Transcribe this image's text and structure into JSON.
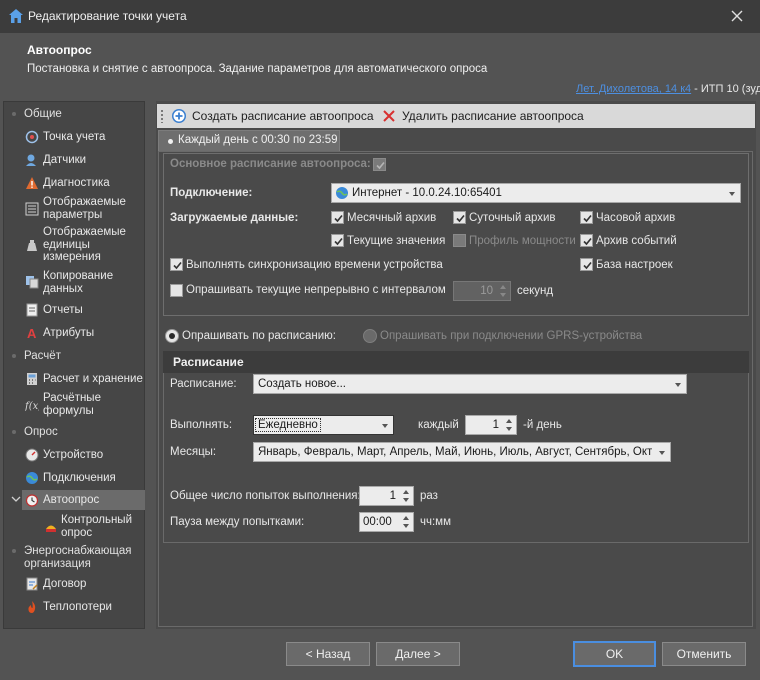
{
  "window": {
    "title": "Редактирование точки учета",
    "close_symbol": "✕"
  },
  "header": {
    "title": "Автоопрос",
    "description": "Постановка и снятие с автоопроса. Задание параметров для автоматического опроса",
    "link_text": "Лет. Дихолетова, 14 к4",
    "link_suffix": " - ИТП 10 (зуд"
  },
  "sidebar": {
    "sections": [
      {
        "label": "Общие"
      },
      {
        "label": "Расчёт"
      },
      {
        "label": "Опрос"
      },
      {
        "label": "Энергоснабжающая организация"
      }
    ],
    "items": [
      {
        "label": "Точка учета",
        "icon": "meter-point-icon"
      },
      {
        "label": "Датчики",
        "icon": "sensors-icon"
      },
      {
        "label": "Диагностика",
        "icon": "warning-icon"
      },
      {
        "label": "Отображаемые параметры",
        "icon": "params-list-icon"
      },
      {
        "label": "Отображаемые единицы измерения",
        "icon": "units-icon"
      },
      {
        "label": "Копирование данных",
        "icon": "copy-icon"
      },
      {
        "label": "Отчеты",
        "icon": "report-icon"
      },
      {
        "label": "Атрибуты",
        "icon": "attributes-icon"
      },
      {
        "label": "Расчет и хранение",
        "icon": "calculator-icon"
      },
      {
        "label": "Расчётные формулы",
        "icon": "formula-icon"
      },
      {
        "label": "Устройство",
        "icon": "device-icon"
      },
      {
        "label": "Подключения",
        "icon": "globe-icon"
      },
      {
        "label": "Автоопрос",
        "icon": "clock-icon"
      },
      {
        "label": "Контрольный опрос",
        "icon": "control-poll-icon"
      },
      {
        "label": "Договор",
        "icon": "contract-icon"
      },
      {
        "label": "Теплопотери",
        "icon": "flame-icon"
      }
    ]
  },
  "toolbar": {
    "create_label": "Создать расписание автоопроса",
    "delete_label": "Удалить расписание автоопроса"
  },
  "tab": {
    "label": "Каждый день с 00:30 по 23:59"
  },
  "form": {
    "main_schedule_label": "Основное расписание автоопроса:",
    "connection_label": "Подключение:",
    "connection_value": "Интернет - 10.0.24.10:65401",
    "loaded_data_label": "Загружаемые данные:",
    "checks": {
      "monthly": "Месячный архив",
      "daily": "Суточный архив",
      "hourly": "Часовой архив",
      "current": "Текущие значения",
      "power_profile": "Профиль мощности",
      "events": "Архив событий",
      "settings_db": "База настроек",
      "time_sync": "Выполнять синхронизацию времени устройства",
      "poll_continuous": "Опрашивать текущие непрерывно с интервалом"
    },
    "interval_value": "10",
    "interval_unit": "секунд",
    "radio_schedule": "Опрашивать по расписанию:",
    "radio_gprs": "Опрашивать при подключении GPRS-устройства"
  },
  "schedule": {
    "header": "Расписание",
    "schedule_label": "Расписание:",
    "schedule_value": "Создать новое...",
    "execute_label": "Выполнять:",
    "execute_value": "Ежедневно",
    "each_label": "каждый",
    "each_value": "1",
    "day_suffix": "-й день",
    "months_label": "Месяцы:",
    "months_value": "Январь, Февраль, Март, Апрель, Май, Июнь, Июль, Август, Сентябрь, Октябрь, Ноябрь, Декабрь",
    "attempts_label": "Общее число попыток выполнения:",
    "attempts_value": "1",
    "attempts_unit": "раз",
    "pause_label": "Пауза между попытками:",
    "pause_value": "00:00",
    "pause_unit": "чч:мм"
  },
  "buttons": {
    "back": "< Назад",
    "next": "Далее >",
    "ok": "OK",
    "cancel": "Отменить"
  },
  "colors": {
    "background": "#535353",
    "titlebar": "#3c3c3c",
    "link": "#4d8fe0",
    "focus_border": "#4a8ee0",
    "toolbar": "#d9d9d9"
  }
}
